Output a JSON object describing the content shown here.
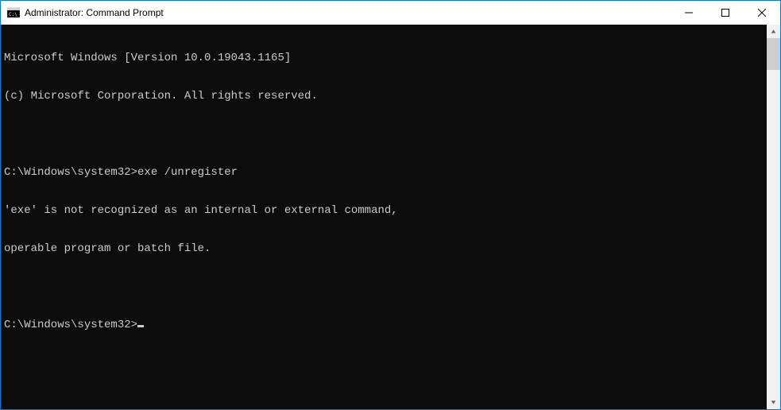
{
  "window": {
    "title": "Administrator: Command Prompt"
  },
  "terminal": {
    "lines": [
      "Microsoft Windows [Version 10.0.19043.1165]",
      "(c) Microsoft Corporation. All rights reserved.",
      "",
      "C:\\Windows\\system32>exe /unregister",
      "'exe' is not recognized as an internal or external command,",
      "operable program or batch file.",
      ""
    ],
    "current_prompt": "C:\\Windows\\system32>"
  }
}
